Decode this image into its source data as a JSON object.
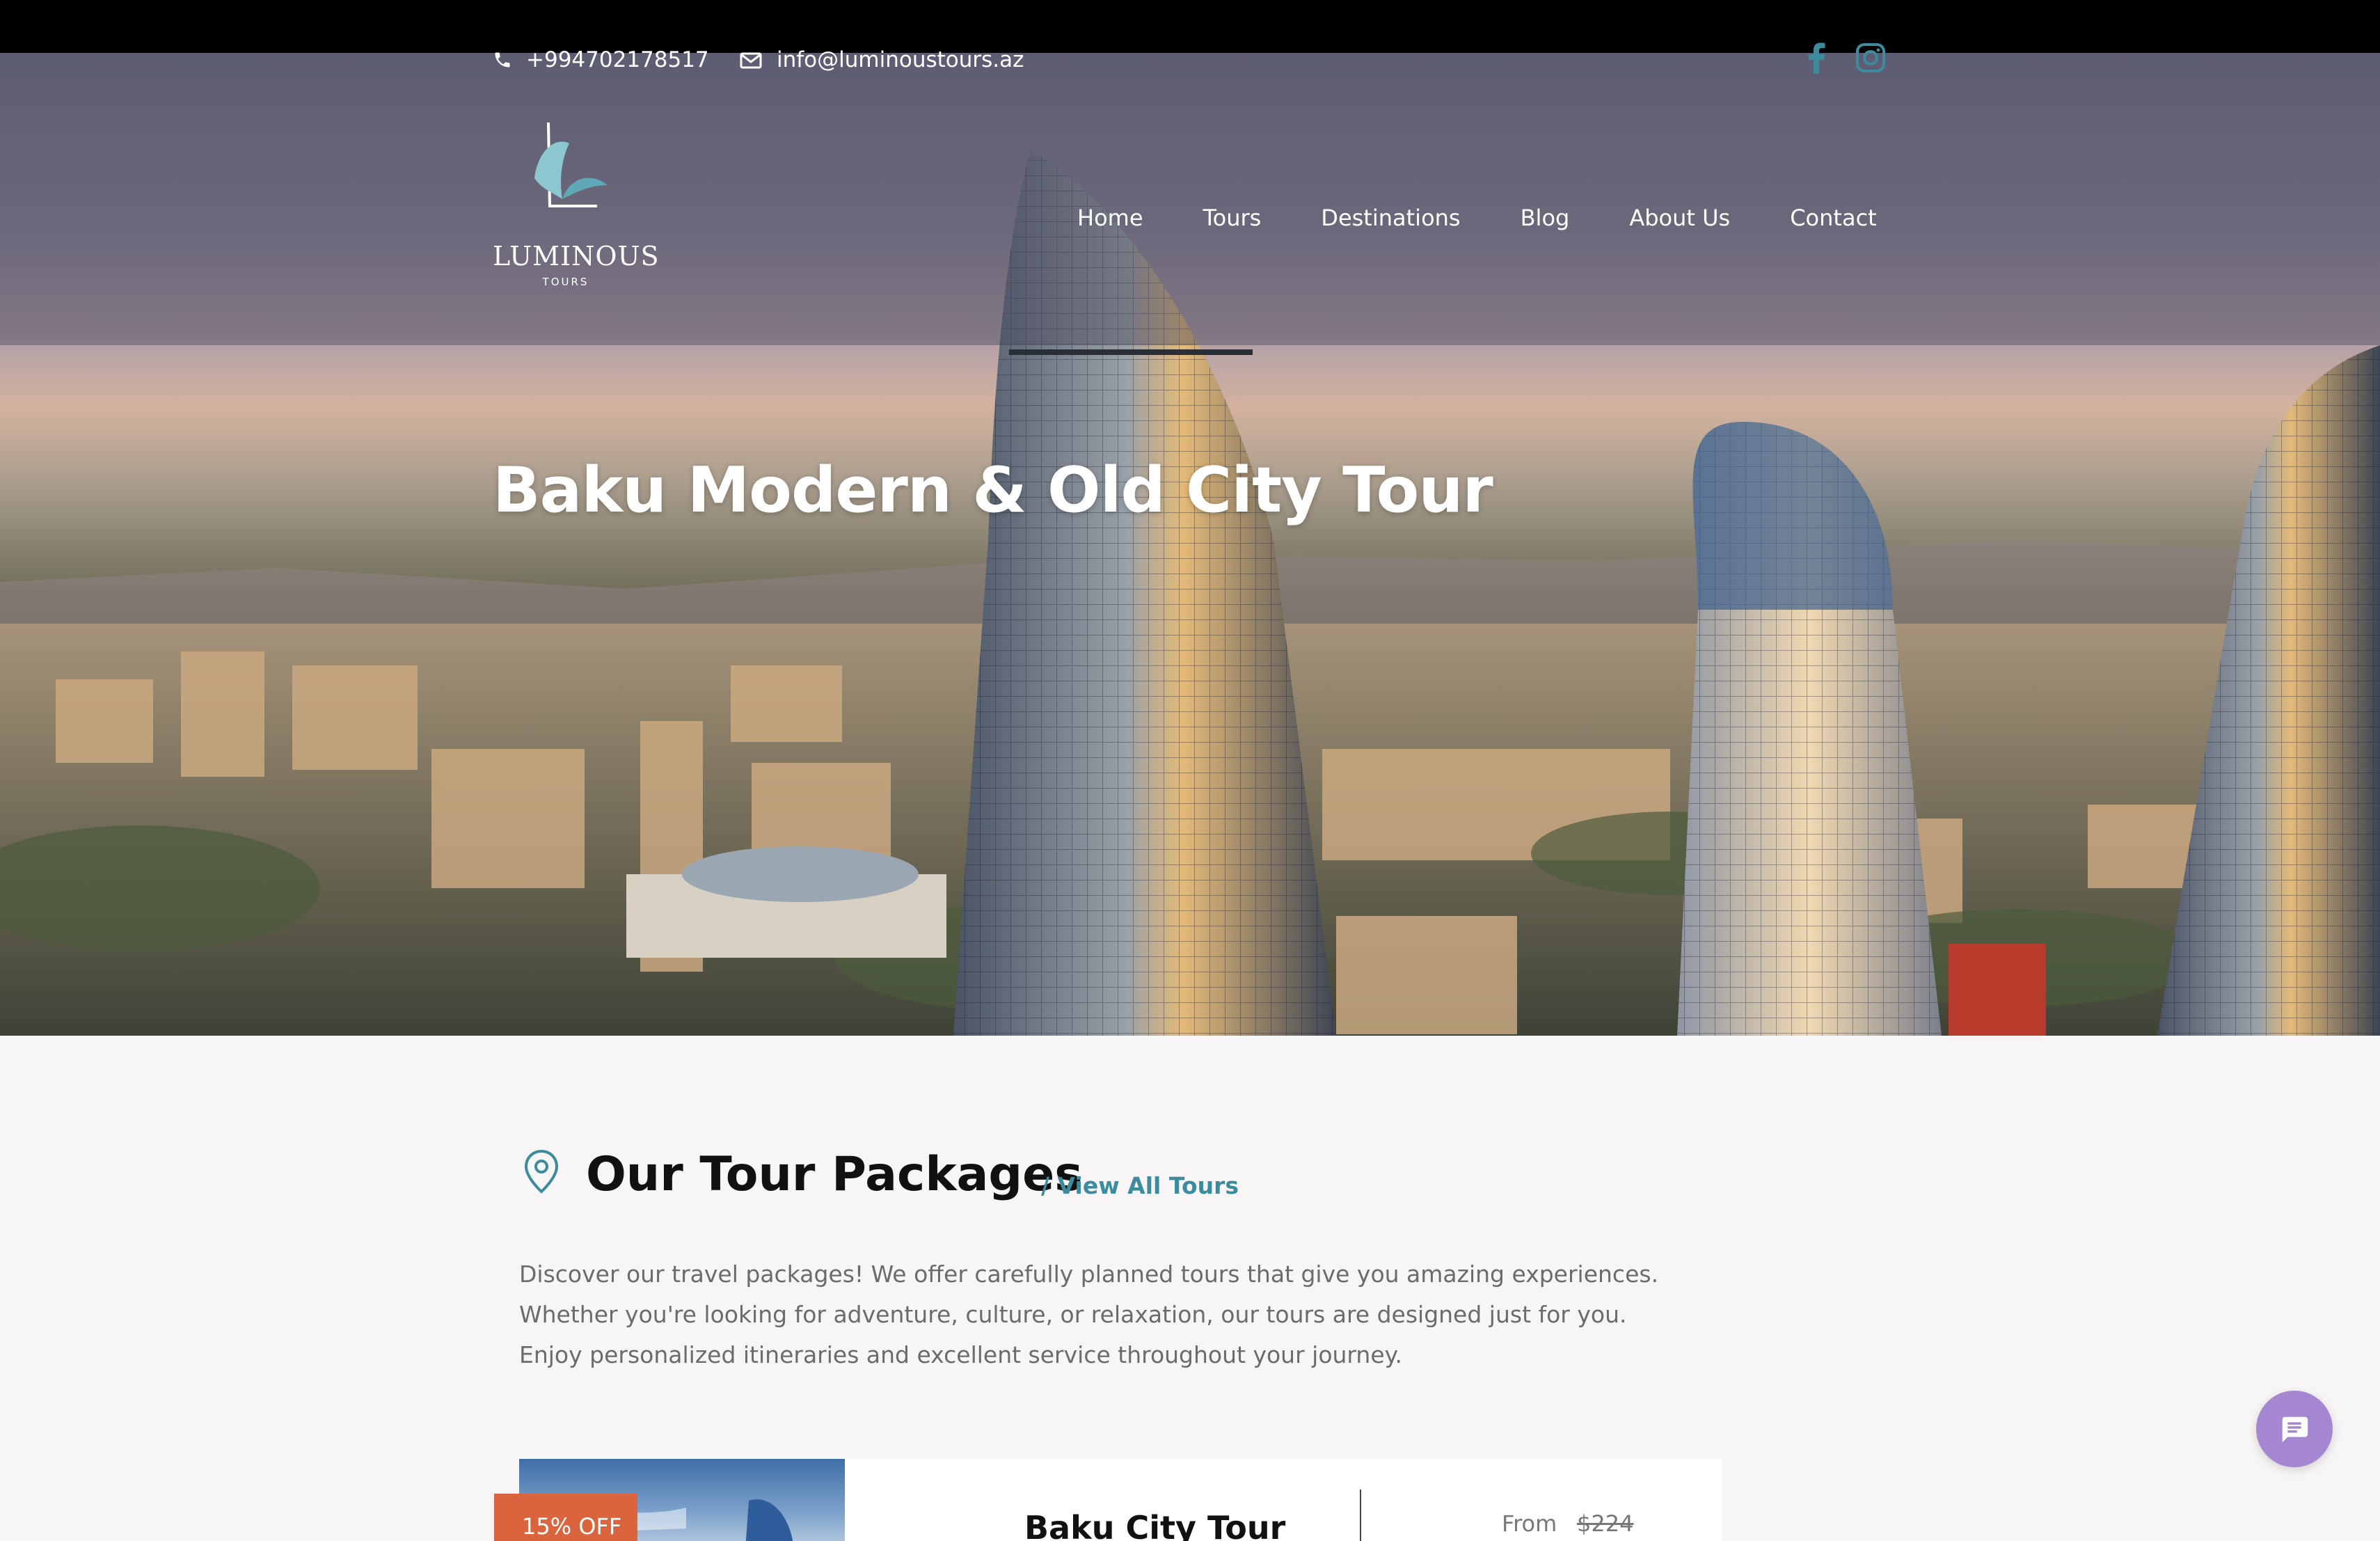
{
  "header": {
    "phone": "+994702178517",
    "email": "info@luminoustours.az",
    "social": [
      "facebook-icon",
      "instagram-icon"
    ]
  },
  "logo": {
    "word": "LUMINOUS",
    "sub": "TOURS"
  },
  "nav": {
    "items": [
      "Home",
      "Tours",
      "Destinations",
      "Blog",
      "About Us",
      "Contact"
    ]
  },
  "hero": {
    "title": "Baku Modern & Old City Tour"
  },
  "packages": {
    "title": "Our Tour Packages",
    "view_all": "/ View All Tours",
    "description": "Discover our travel packages! We offer carefully planned tours that give you amazing experiences. Whether you're looking for adventure, culture, or relaxation, our tours are designed just for you. Enjoy personalized itineraries and excellent service throughout your journey."
  },
  "card": {
    "badge": "15% OFF",
    "title": "Baku City Tour",
    "price_from": "From",
    "price_old": "$224"
  },
  "colors": {
    "accent": "#3d8c9e",
    "badge": "#d9643d",
    "chat": "#a487d0"
  }
}
